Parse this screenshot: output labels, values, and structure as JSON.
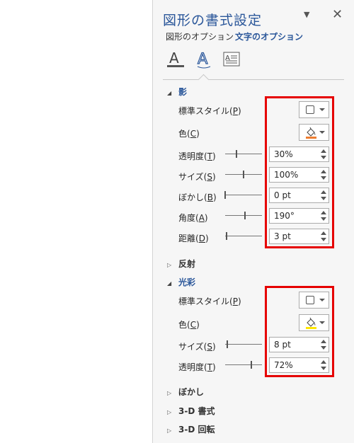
{
  "pane": {
    "title": "図形の書式設定",
    "tabs": [
      "図形のオプション",
      "文字のオプション"
    ]
  },
  "shadow": {
    "header": "影",
    "rows": [
      {
        "label": "標準スタイル",
        "key": "P"
      },
      {
        "label": "色",
        "key": "C"
      },
      {
        "label": "透明度",
        "key": "T",
        "value": "30%",
        "level": 0.3
      },
      {
        "label": "サイズ",
        "key": "S",
        "value": "100%",
        "level": 0.5
      },
      {
        "label": "ぼかし",
        "key": "B",
        "value": "0 pt",
        "level": 0
      },
      {
        "label": "角度",
        "key": "A",
        "value": "190°",
        "level": 0.53
      },
      {
        "label": "距離",
        "key": "D",
        "value": "3 pt",
        "level": 0.03
      }
    ],
    "color": "#ed7d31"
  },
  "reflection": {
    "header": "反射"
  },
  "glow": {
    "header": "光彩",
    "rows": [
      {
        "label": "標準スタイル",
        "key": "P"
      },
      {
        "label": "色",
        "key": "C"
      },
      {
        "label": "サイズ",
        "key": "S",
        "value": "8 pt",
        "level": 0.05
      },
      {
        "label": "透明度",
        "key": "T",
        "value": "72%",
        "level": 0.72
      }
    ],
    "color": "#ffe600"
  },
  "soft_edges": {
    "header": "ぼかし"
  },
  "format_3d": {
    "header": "3-D 書式"
  },
  "rotation_3d": {
    "header": "3-D 回転"
  },
  "colors": {
    "accent": "#2b579a",
    "highlight_box": "#e60000"
  }
}
